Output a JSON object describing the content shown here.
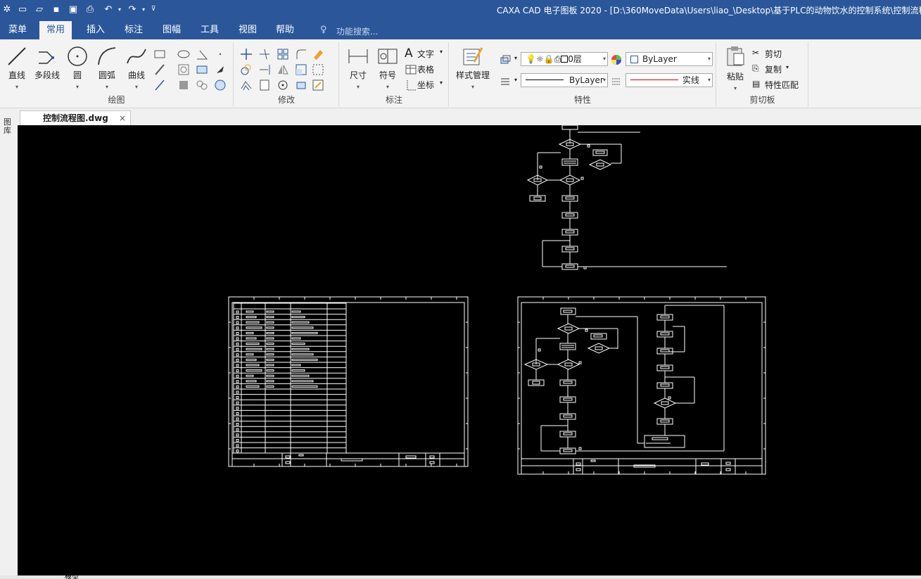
{
  "app": {
    "title": "CAXA CAD 电子图板 2020 - [D:\\360MoveData\\Users\\liao_\\Desktop\\基于PLC的动物饮水的控制系统\\控制流程图"
  },
  "menu": {
    "tabs": [
      {
        "label": "菜单"
      },
      {
        "label": "常用",
        "active": true
      },
      {
        "label": "插入"
      },
      {
        "label": "标注"
      },
      {
        "label": "图幅"
      },
      {
        "label": "工具"
      },
      {
        "label": "视图"
      },
      {
        "label": "帮助"
      }
    ],
    "search_placeholder": "功能搜索..."
  },
  "ribbon": {
    "draw": {
      "label": "绘图",
      "line": "直线",
      "polyline": "多段线",
      "circle": "圆",
      "arc": "圆弧",
      "curve": "曲线"
    },
    "modify": {
      "label": "修改"
    },
    "annotate": {
      "label": "标注",
      "dimension": "尺寸",
      "symbol": "符号",
      "text": "文字",
      "table": "表格",
      "coordinate": "坐标"
    },
    "properties": {
      "label": "特性",
      "style_manager": "样式管理",
      "layer": "0层",
      "color": "ByLayer",
      "linetype": "ByLayer",
      "lineweight": "实线"
    },
    "clipboard": {
      "label": "剪切板",
      "paste": "粘贴",
      "cut": "剪切",
      "copy": "复制",
      "match": "特性匹配"
    }
  },
  "document": {
    "tab": "控制流程图.dwg",
    "library_label": "图库",
    "layout_tab": "模型"
  },
  "colors": {
    "accent": "#2b579a",
    "canvas": "#000000",
    "drawing_line": "#ffffff"
  }
}
